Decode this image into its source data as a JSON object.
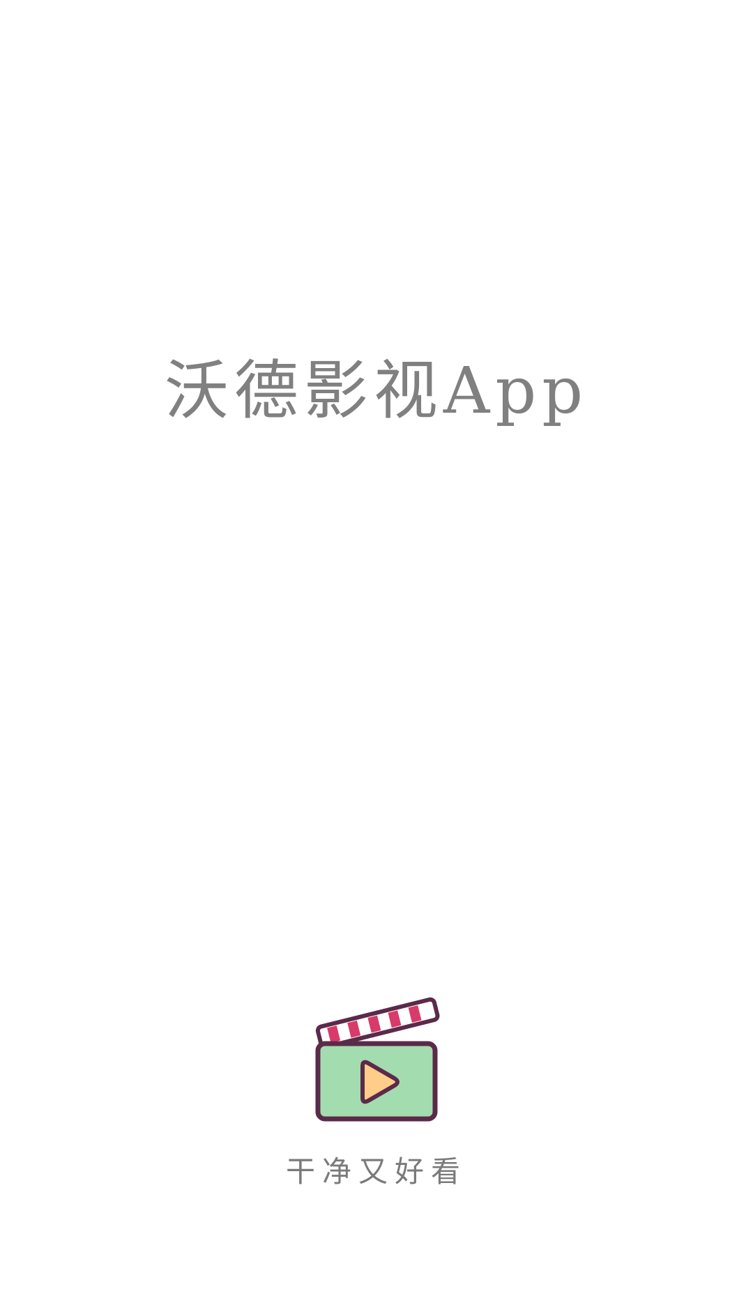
{
  "splash": {
    "title": "沃德影视App",
    "slogan": "干净又好看",
    "logo_icon": "clapperboard-play-icon",
    "colors": {
      "background": "#ffffff",
      "text": "#808080",
      "outline": "#5b2a4a",
      "board_fill": "#a3dcae",
      "play_fill": "#ffcc8a",
      "stripe_accent": "#d83a6a"
    }
  }
}
